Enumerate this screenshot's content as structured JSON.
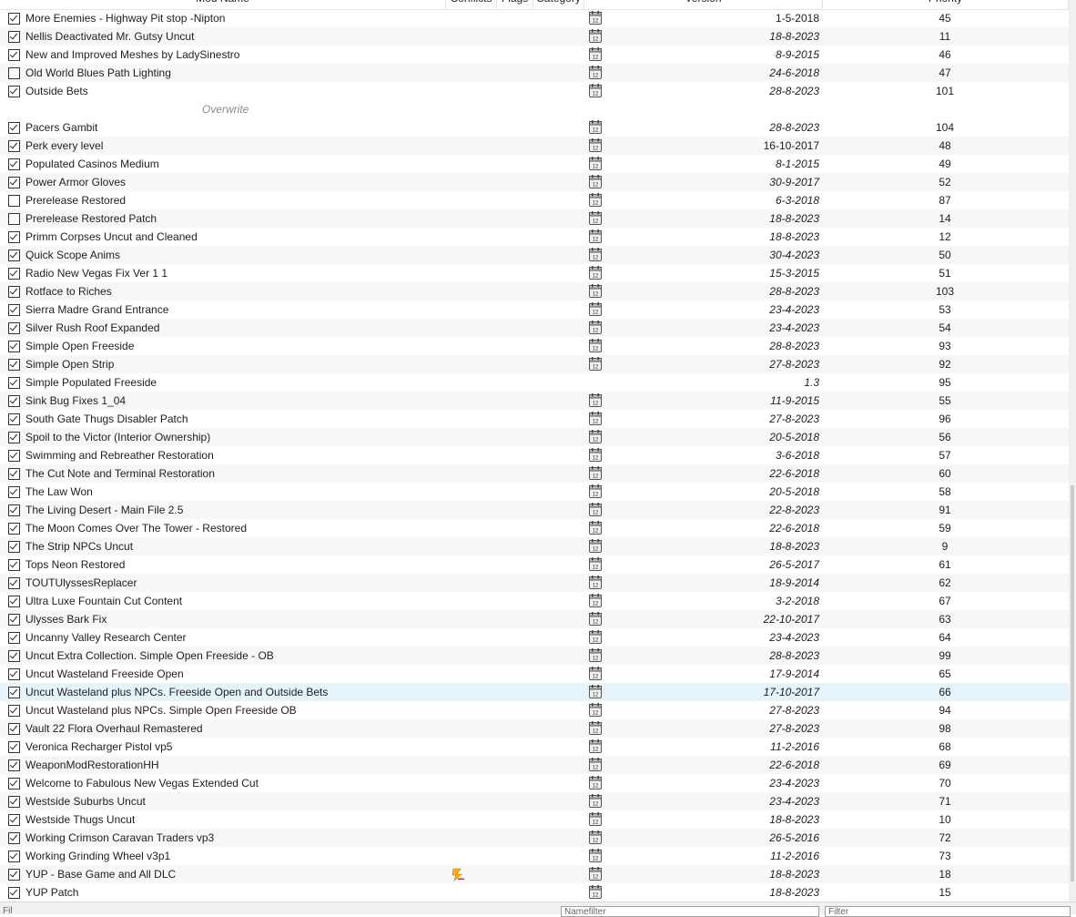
{
  "columns": {
    "mod_name": "Mod Name",
    "conflicts": "Conflicts",
    "flags": "Flags",
    "category": "Category",
    "version": "Version",
    "priority": "Priority"
  },
  "rows": [
    {
      "name": "More Enemies - Highway Pit stop -Nipton",
      "checked": true,
      "version": "1-5-2018",
      "italic": false,
      "priority": "45",
      "nexus": true
    },
    {
      "name": "Nellis Deactivated Mr. Gutsy Uncut",
      "checked": true,
      "version": "18-8-2023",
      "italic": true,
      "priority": "11",
      "nexus": true
    },
    {
      "name": "New and Improved Meshes by LadySinestro",
      "checked": true,
      "version": "8-9-2015",
      "italic": true,
      "priority": "46",
      "nexus": true
    },
    {
      "name": "Old World Blues Path Lighting",
      "checked": false,
      "version": "24-6-2018",
      "italic": true,
      "priority": "47",
      "nexus": true
    },
    {
      "name": "Outside Bets",
      "checked": true,
      "version": "28-8-2023",
      "italic": true,
      "priority": "101",
      "nexus": true
    },
    {
      "separator": true,
      "name": "Overwrite"
    },
    {
      "name": "Pacers Gambit",
      "checked": true,
      "version": "28-8-2023",
      "italic": true,
      "priority": "104",
      "nexus": true
    },
    {
      "name": "Perk every level",
      "checked": true,
      "version": "16-10-2017",
      "italic": false,
      "priority": "48",
      "nexus": true
    },
    {
      "name": "Populated Casinos Medium",
      "checked": true,
      "version": "8-1-2015",
      "italic": true,
      "priority": "49",
      "nexus": true
    },
    {
      "name": "Power Armor Gloves",
      "checked": true,
      "version": "30-9-2017",
      "italic": true,
      "priority": "52",
      "nexus": true
    },
    {
      "name": "Prerelease Restored",
      "checked": false,
      "version": "6-3-2018",
      "italic": true,
      "priority": "87",
      "nexus": true
    },
    {
      "name": "Prerelease Restored Patch",
      "checked": false,
      "version": "18-8-2023",
      "italic": true,
      "priority": "14",
      "nexus": true
    },
    {
      "name": "Primm Corpses Uncut and Cleaned",
      "checked": true,
      "version": "18-8-2023",
      "italic": true,
      "priority": "12",
      "nexus": true
    },
    {
      "name": "Quick Scope Anims",
      "checked": true,
      "version": "30-4-2023",
      "italic": true,
      "priority": "50",
      "nexus": true
    },
    {
      "name": "Radio New Vegas Fix Ver 1 1",
      "checked": true,
      "version": "15-3-2015",
      "italic": true,
      "priority": "51",
      "nexus": true
    },
    {
      "name": "Rotface to Riches",
      "checked": true,
      "version": "28-8-2023",
      "italic": true,
      "priority": "103",
      "nexus": true
    },
    {
      "name": "Sierra Madre Grand Entrance",
      "checked": true,
      "version": "23-4-2023",
      "italic": true,
      "priority": "53",
      "nexus": true
    },
    {
      "name": "Silver Rush Roof Expanded",
      "checked": true,
      "version": "23-4-2023",
      "italic": true,
      "priority": "54",
      "nexus": true
    },
    {
      "name": "Simple Open Freeside",
      "checked": true,
      "version": "28-8-2023",
      "italic": true,
      "priority": "93",
      "nexus": true
    },
    {
      "name": "Simple Open Strip",
      "checked": true,
      "version": "27-8-2023",
      "italic": true,
      "priority": "92",
      "nexus": true
    },
    {
      "name": "Simple Populated Freeside",
      "checked": true,
      "version": "1.3",
      "italic": true,
      "priority": "95",
      "nexus": false
    },
    {
      "name": "Sink Bug Fixes 1_04",
      "checked": true,
      "version": "11-9-2015",
      "italic": true,
      "priority": "55",
      "nexus": true
    },
    {
      "name": "South Gate Thugs Disabler Patch",
      "checked": true,
      "version": "27-8-2023",
      "italic": true,
      "priority": "96",
      "nexus": true
    },
    {
      "name": "Spoil to the Victor (Interior Ownership)",
      "checked": true,
      "version": "20-5-2018",
      "italic": true,
      "priority": "56",
      "nexus": true
    },
    {
      "name": "Swimming and Rebreather Restoration",
      "checked": true,
      "version": "3-6-2018",
      "italic": true,
      "priority": "57",
      "nexus": true
    },
    {
      "name": "The Cut Note and Terminal Restoration",
      "checked": true,
      "version": "22-6-2018",
      "italic": true,
      "priority": "60",
      "nexus": true
    },
    {
      "name": "The Law Won",
      "checked": true,
      "version": "20-5-2018",
      "italic": true,
      "priority": "58",
      "nexus": true
    },
    {
      "name": "The Living Desert - Main File 2.5",
      "checked": true,
      "version": "22-8-2023",
      "italic": true,
      "priority": "91",
      "nexus": true
    },
    {
      "name": "The Moon Comes Over The Tower - Restored",
      "checked": true,
      "version": "22-6-2018",
      "italic": true,
      "priority": "59",
      "nexus": true
    },
    {
      "name": "The Strip NPCs Uncut",
      "checked": true,
      "version": "18-8-2023",
      "italic": true,
      "priority": "9",
      "nexus": true
    },
    {
      "name": "Tops Neon Restored",
      "checked": true,
      "version": "26-5-2017",
      "italic": true,
      "priority": "61",
      "nexus": true
    },
    {
      "name": "TOUTUlyssesReplacer",
      "checked": true,
      "version": "18-9-2014",
      "italic": true,
      "priority": "62",
      "nexus": true
    },
    {
      "name": "Ultra Luxe Fountain Cut Content",
      "checked": true,
      "version": "3-2-2018",
      "italic": true,
      "priority": "67",
      "nexus": true
    },
    {
      "name": "Ulysses Bark Fix",
      "checked": true,
      "version": "22-10-2017",
      "italic": true,
      "priority": "63",
      "nexus": true
    },
    {
      "name": "Uncanny Valley Research Center",
      "checked": true,
      "version": "23-4-2023",
      "italic": true,
      "priority": "64",
      "nexus": true
    },
    {
      "name": "Uncut Extra Collection. Simple Open Freeside - OB",
      "checked": true,
      "version": "28-8-2023",
      "italic": true,
      "priority": "99",
      "nexus": true
    },
    {
      "name": "Uncut Wasteland Freeside Open",
      "checked": true,
      "version": "17-9-2014",
      "italic": true,
      "priority": "65",
      "nexus": true
    },
    {
      "name": "Uncut Wasteland plus NPCs. Freeside Open and Outside Bets",
      "checked": true,
      "version": "17-10-2017",
      "italic": true,
      "priority": "66",
      "nexus": true,
      "selected": true
    },
    {
      "name": "Uncut Wasteland plus NPCs. Simple Open Freeside OB",
      "checked": true,
      "version": "27-8-2023",
      "italic": true,
      "priority": "94",
      "nexus": true
    },
    {
      "name": "Vault 22 Flora Overhaul Remastered",
      "checked": true,
      "version": "27-8-2023",
      "italic": true,
      "priority": "98",
      "nexus": true
    },
    {
      "name": "Veronica Recharger Pistol vp5",
      "checked": true,
      "version": "11-2-2016",
      "italic": true,
      "priority": "68",
      "nexus": true
    },
    {
      "name": "WeaponModRestorationHH",
      "checked": true,
      "version": "22-6-2018",
      "italic": true,
      "priority": "69",
      "nexus": true
    },
    {
      "name": "Welcome to Fabulous New Vegas Extended Cut",
      "checked": true,
      "version": "23-4-2023",
      "italic": true,
      "priority": "70",
      "nexus": true
    },
    {
      "name": "Westside Suburbs Uncut",
      "checked": true,
      "version": "23-4-2023",
      "italic": true,
      "priority": "71",
      "nexus": true
    },
    {
      "name": "Westside Thugs Uncut",
      "checked": true,
      "version": "18-8-2023",
      "italic": true,
      "priority": "10",
      "nexus": true
    },
    {
      "name": "Working Crimson Caravan Traders vp3",
      "checked": true,
      "version": "26-5-2016",
      "italic": true,
      "priority": "72",
      "nexus": true
    },
    {
      "name": "Working Grinding Wheel v3p1",
      "checked": true,
      "version": "11-2-2016",
      "italic": true,
      "priority": "73",
      "nexus": true
    },
    {
      "name": "YUP - Base Game and All DLC",
      "checked": true,
      "version": "18-8-2023",
      "italic": true,
      "priority": "18",
      "nexus": true,
      "flag": "flag-redundant-icon"
    },
    {
      "name": "YUP Patch",
      "checked": true,
      "version": "18-8-2023",
      "italic": true,
      "priority": "15",
      "nexus": true
    }
  ],
  "filter_bar": {
    "left_label": "Filter",
    "middle_placeholder": "Namefilter",
    "right_placeholder": "Filter"
  },
  "colors": {
    "selected_row": "#e5f3fb",
    "alt_row": "#f7f7f7",
    "separator_text": "#8a8a8a",
    "flag_icon": "#e8a317"
  }
}
